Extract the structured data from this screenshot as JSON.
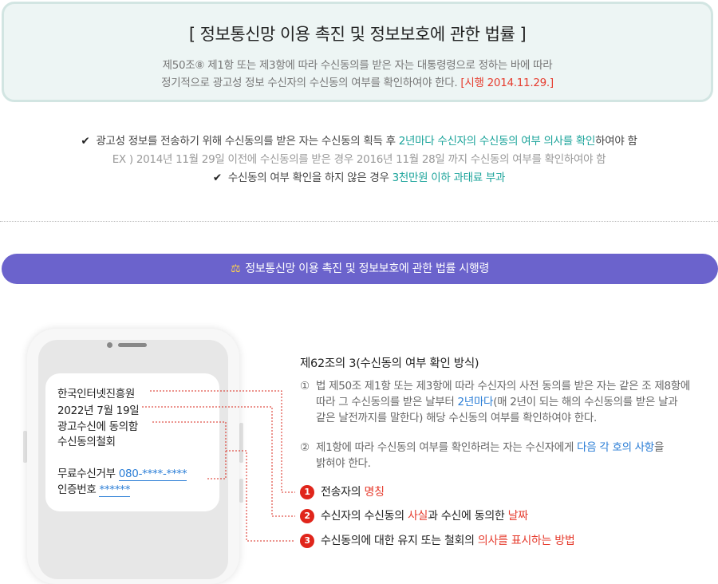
{
  "law_box": {
    "title": "[ 정보통신망 이용 촉진 및 정보보호에 관한 법률 ]",
    "line1": "제50조⑧ 제1항 또는 제3항에 따라 수신동의를 받은 자는 대통령령으로 정하는 바에 따라",
    "line2": "정기적으로 광고성 정보 수신자의 수신동의  여부를 확인하여야 한다.",
    "enforcement": "[시행 2014.11.29.]"
  },
  "summary": {
    "check1_pre": "광고성 정보를 전송하기 위해 수신동의를 받은 자는 수신동의 획득 후 ",
    "check1_highlight": "2년마다 수신자의 수신동의 여부 의사를 확인",
    "check1_post": "하여야 함",
    "example": "EX ) 2014년 11월 29일 이전에 수신동의를 받은 경우 2016년 11월 28일 까지 수신동의 여부를 확인하여야 함",
    "check2_pre": "수신동의 여부 확인을 하지 않은 경우 ",
    "check2_highlight": "3천만원 이하 과태료 부과",
    "check_icon": "✔"
  },
  "decree_bar": {
    "icon": "⚖",
    "label": "정보통신망 이용 촉진 및 정보보호에 관한 법률 시행령"
  },
  "sms": {
    "sender": "한국인터넷진흥원",
    "date": "2022년 7월 19일",
    "consent": "광고수신에 동의함",
    "withdraw": "수신동의철회",
    "reject_label": "무료수신거부 ",
    "reject_number": "080-****-****",
    "auth_label": "인증번호 ",
    "auth_code": "******"
  },
  "rule": {
    "title": "제62조의 3(수신동의 여부 확인 방식)",
    "p1_num": "①",
    "p1_line1": "법 제50조 제1항 또는 제3항에 따라 수신자의 사전 동의를 받은 자는 같은 조 제8항에",
    "p1_line2_pre": "따라 그 수신동의를 받은 날부터 ",
    "p1_line2_highlight": "2년마다",
    "p1_line2_post": "(매 2년이 되는 해의 수신동의를 받은 날과",
    "p1_line3": "같은 날전까지를 말한다) 해당 수신동의 여부를 확인하여야 한다.",
    "p2_num": "②",
    "p2_line1_pre": "제1항에 따라 수신동의 여부를 확인하려는 자는 수신자에게 ",
    "p2_line1_highlight": "다음 각 호의 사항",
    "p2_line1_post": "을",
    "p2_line2": "밝혀야 한다."
  },
  "items": [
    {
      "num": "1",
      "pre": "전송자의 ",
      "highlight": "명칭",
      "mid": "",
      "highlight2": ""
    },
    {
      "num": "2",
      "pre": "수신자의 수신동의 ",
      "highlight": "사실",
      "mid": "과 수신에 동의한 ",
      "highlight2": "날짜"
    },
    {
      "num": "3",
      "pre": "수신동의에 대한 유지 또는 철회의 ",
      "highlight": "의사를 표시하는 방법",
      "mid": "",
      "highlight2": ""
    }
  ],
  "colors": {
    "accent_teal": "#1aa39a",
    "highlight_red": "#e63c2e",
    "link_blue": "#2a7dd6",
    "decree_bar": "#6b63cc",
    "badge_red": "#e0251b"
  }
}
